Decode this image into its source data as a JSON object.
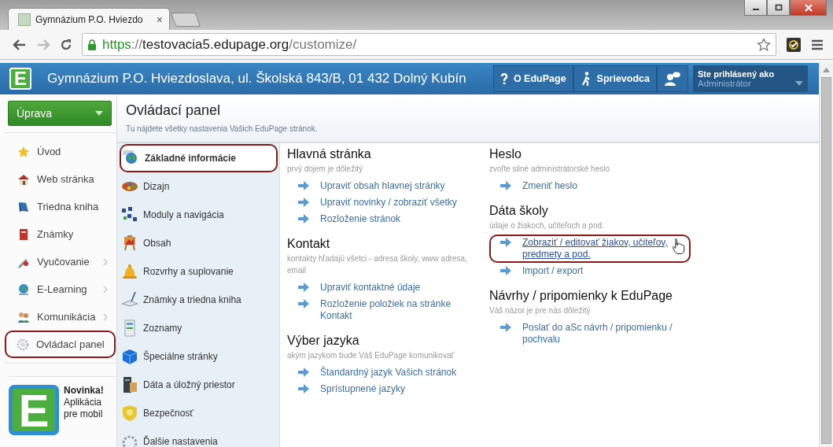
{
  "browser": {
    "tab": {
      "title": "Gymnázium P.O. Hviezdo",
      "close": "×"
    },
    "address": {
      "scheme": "https",
      "separator": "://",
      "host": "testovacia5.edupage.org",
      "path": "/customize/"
    }
  },
  "header": {
    "logo": "E",
    "school": "Gymnázium P.O. Hviezdoslava, ul. Školská 843/B, 01 432 Dolný Kubín",
    "buttons": [
      {
        "kind": "help",
        "label": "O EduPage"
      },
      {
        "kind": "guide",
        "label": "Sprievodca"
      },
      {
        "kind": "chat"
      }
    ],
    "user": {
      "caption": "Ste prihlásený ako",
      "role": "Administrátor"
    }
  },
  "sidebar": {
    "menu_button": "Úprava",
    "items": [
      {
        "label": "Úvod",
        "has_submenu": false,
        "highlighted": false
      },
      {
        "label": "Web stránka",
        "has_submenu": false,
        "highlighted": false
      },
      {
        "label": "Triedna kniha",
        "has_submenu": false,
        "highlighted": false
      },
      {
        "label": "Známky",
        "has_submenu": false,
        "highlighted": false
      },
      {
        "label": "Vyučovanie",
        "has_submenu": true,
        "highlighted": false
      },
      {
        "label": "E-Learning",
        "has_submenu": true,
        "highlighted": false
      },
      {
        "label": "Komunikácia",
        "has_submenu": true,
        "highlighted": false
      },
      {
        "label": "Ovládací panel",
        "has_submenu": false,
        "highlighted": true
      }
    ],
    "promo": {
      "logo": "E",
      "title": "Novinka!",
      "text": "Aplikácia pre mobil"
    }
  },
  "page": {
    "title": "Ovládací panel",
    "subtitle": "Tu nájdete všetky nastavenia Vašich EduPage stránok."
  },
  "categories": [
    {
      "label": "Základné informácie",
      "selected": true,
      "highlighted": true
    },
    {
      "label": "Dizajn",
      "selected": false,
      "highlighted": false
    },
    {
      "label": "Moduly a navigácia",
      "selected": false,
      "highlighted": false
    },
    {
      "label": "Obsah",
      "selected": false,
      "highlighted": false
    },
    {
      "label": "Rozvrhy a suplovanie",
      "selected": false,
      "highlighted": false
    },
    {
      "label": "Známky a triedna kniha",
      "selected": false,
      "highlighted": false
    },
    {
      "label": "Zoznamy",
      "selected": false,
      "highlighted": false
    },
    {
      "label": "Špeciálne stránky",
      "selected": false,
      "highlighted": false
    },
    {
      "label": "Dáta a úložný priestor",
      "selected": false,
      "highlighted": false
    },
    {
      "label": "Bezpečnosť",
      "selected": false,
      "highlighted": false
    },
    {
      "label": "Ďalšie nastavenia",
      "selected": false,
      "highlighted": false
    }
  ],
  "columns": [
    [
      {
        "title": "Hlavná stránka",
        "subtitle": "prvý dojem je dôležitý",
        "links": [
          {
            "label": "Upraviť obsah hlavnej stránky",
            "hovered": false,
            "highlighted": false
          },
          {
            "label": "Upraviť novinky / zobraziť všetky",
            "hovered": false,
            "highlighted": false
          },
          {
            "label": "Rozloženie stránok",
            "hovered": false,
            "highlighted": false
          }
        ]
      },
      {
        "title": "Kontakt",
        "subtitle": "kontakty hľadajú všetci - adresa školy, www adresa, email",
        "links": [
          {
            "label": "Upraviť kontaktné údaje",
            "hovered": false,
            "highlighted": false
          },
          {
            "label": "Rozloženie položiek na stránke Kontakt",
            "hovered": false,
            "highlighted": false
          }
        ]
      },
      {
        "title": "Výber jazyka",
        "subtitle": "akým jazykom bude Váš EduPage komunikovať",
        "links": [
          {
            "label": "Štandardný jazyk Vašich stránok",
            "hovered": false,
            "highlighted": false
          },
          {
            "label": "Sprístupnené jazyky",
            "hovered": false,
            "highlighted": false
          }
        ]
      }
    ],
    [
      {
        "title": "Heslo",
        "subtitle": "zvoľte silné administrátorské heslo",
        "links": [
          {
            "label": "Zmeniť heslo",
            "hovered": false,
            "highlighted": false
          }
        ]
      },
      {
        "title": "Dáta školy",
        "subtitle": "údaje o žiakoch, učiteľoch a pod.",
        "links": [
          {
            "label": "Zobraziť / editovať žiakov, učiteľov, predmety a pod.",
            "hovered": true,
            "highlighted": true
          },
          {
            "label": "Import / export",
            "hovered": false,
            "highlighted": false
          }
        ]
      },
      {
        "title": "Návrhy / pripomienky k EduPage",
        "subtitle": "Váš názor je pre nás dôležitý",
        "links": [
          {
            "label": "Poslať do aSc návrh / pripomienku / pochvalu",
            "hovered": false,
            "highlighted": false
          }
        ]
      }
    ]
  ]
}
